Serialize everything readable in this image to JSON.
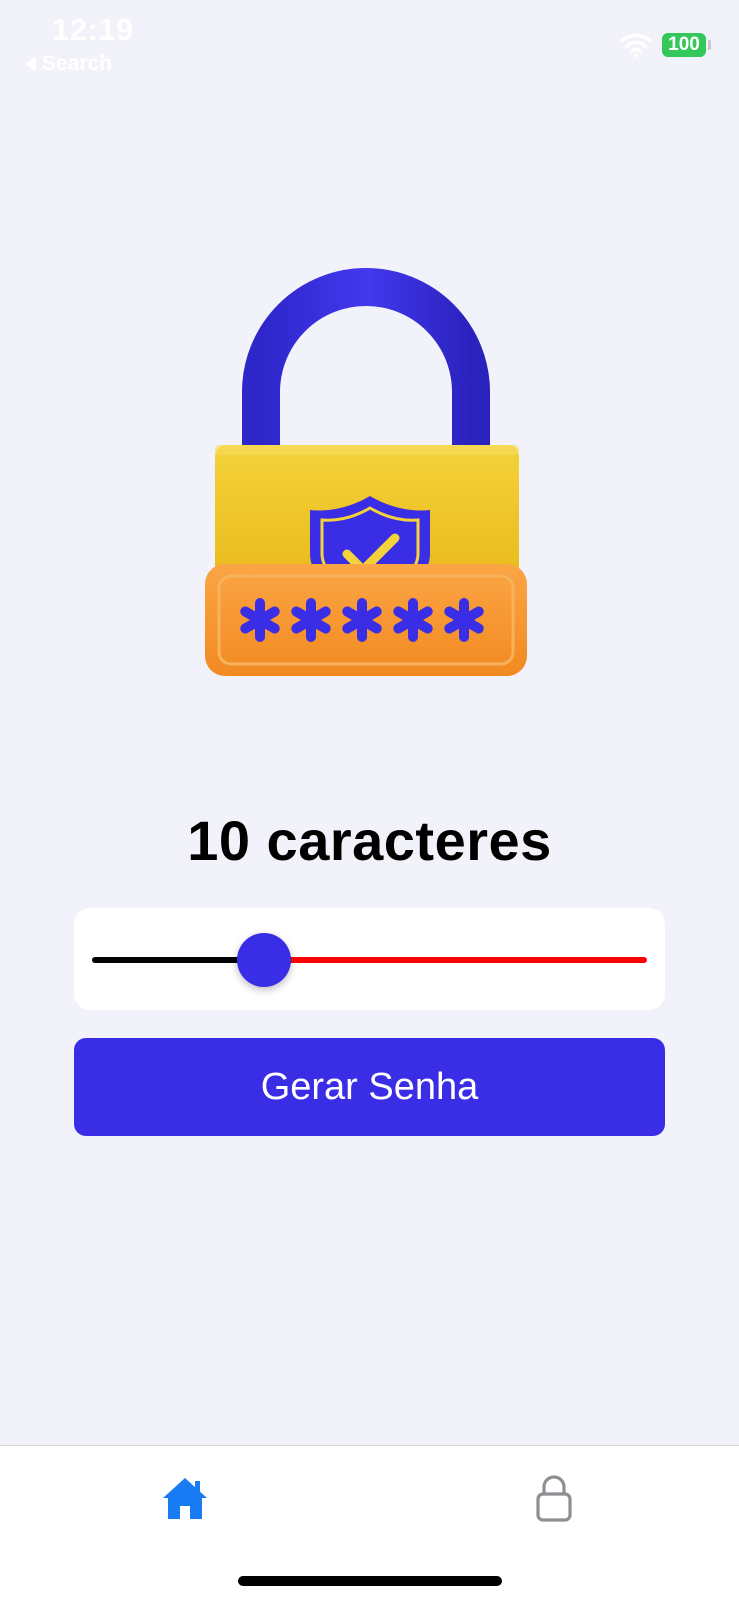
{
  "status_bar": {
    "time": "12:19",
    "back_label": "Search",
    "battery_level": "100"
  },
  "hero": {
    "icon": "padlock-password-icon",
    "masked_password": "*****"
  },
  "generator": {
    "length_label": "10 caracteres",
    "slider_value_fraction": 0.31,
    "button_label": "Gerar Senha"
  },
  "tab_bar": {
    "tabs": [
      {
        "icon": "home-icon",
        "active": true
      },
      {
        "icon": "lock-icon",
        "active": false
      }
    ]
  },
  "colors": {
    "background": "#f2f2fa",
    "accent": "#3a2de6",
    "slider_min_track": "#000000",
    "slider_max_track": "#ff0000",
    "tab_active": "#1a7cf5",
    "tab_inactive": "#8e8e93",
    "lock_body": "#f2c81f",
    "lock_plate": "#f79a32"
  }
}
